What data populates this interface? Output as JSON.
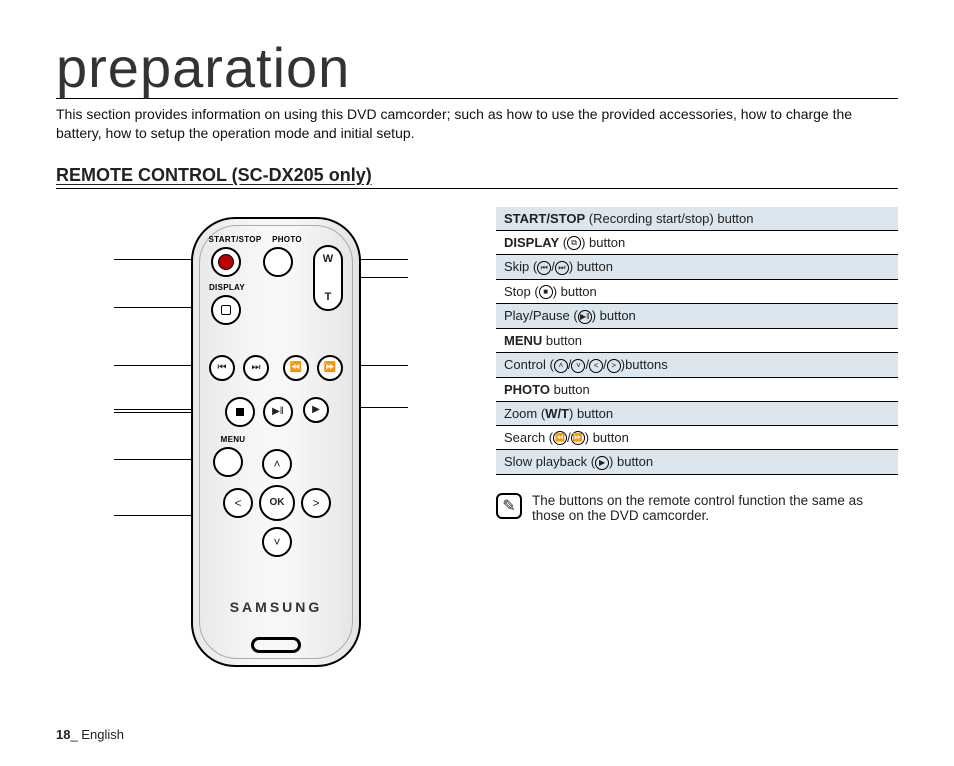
{
  "page": {
    "title": "preparation",
    "intro": "This section provides information on using this DVD camcorder; such as how to use the provided accessories, how to charge the battery, how to setup the operation mode and initial setup.",
    "section_heading": "REMOTE CONTROL (SC-DX205 only)",
    "footer_page": "18",
    "footer_lang": "_ English"
  },
  "remote": {
    "labels": {
      "start_stop": "START/STOP",
      "photo": "PHOTO",
      "display": "DISPLAY",
      "menu": "MENU",
      "w": "W",
      "t": "T",
      "ok": "OK",
      "brand": "SAMSUNG"
    }
  },
  "list": {
    "items": [
      {
        "bold": "START/STOP",
        "rest": " (Recording start/stop) button",
        "icons": []
      },
      {
        "bold": "DISPLAY",
        "rest": " (",
        "icons": [
          "display"
        ],
        "tail": ") button"
      },
      {
        "bold": "",
        "rest": "Skip (",
        "icons": [
          "skip-back",
          "slash",
          "skip-fwd"
        ],
        "tail": ") button"
      },
      {
        "bold": "",
        "rest": "Stop (",
        "icons": [
          "stop"
        ],
        "tail": ") button"
      },
      {
        "bold": "",
        "rest": "Play/Pause (",
        "icons": [
          "playpause"
        ],
        "tail": ") button"
      },
      {
        "bold": "MENU",
        "rest": " button",
        "icons": []
      },
      {
        "bold": "",
        "rest": "Control (",
        "icons": [
          "up",
          "slash",
          "down",
          "slash",
          "left",
          "slash",
          "right"
        ],
        "tail": ")buttons"
      },
      {
        "bold": "PHOTO",
        "rest": " button",
        "icons": []
      },
      {
        "bold": "",
        "rest": "Zoom (",
        "boldmid": "W/T",
        "tail": ") button",
        "icons": []
      },
      {
        "bold": "",
        "rest": "Search (",
        "icons": [
          "rew",
          "slash",
          "ffwd"
        ],
        "tail": ") button"
      },
      {
        "bold": "",
        "rest": "Slow playback (",
        "icons": [
          "slow"
        ],
        "tail": ") button"
      }
    ]
  },
  "note": {
    "text": "The buttons on the remote control function the same as those on the DVD camcorder."
  }
}
